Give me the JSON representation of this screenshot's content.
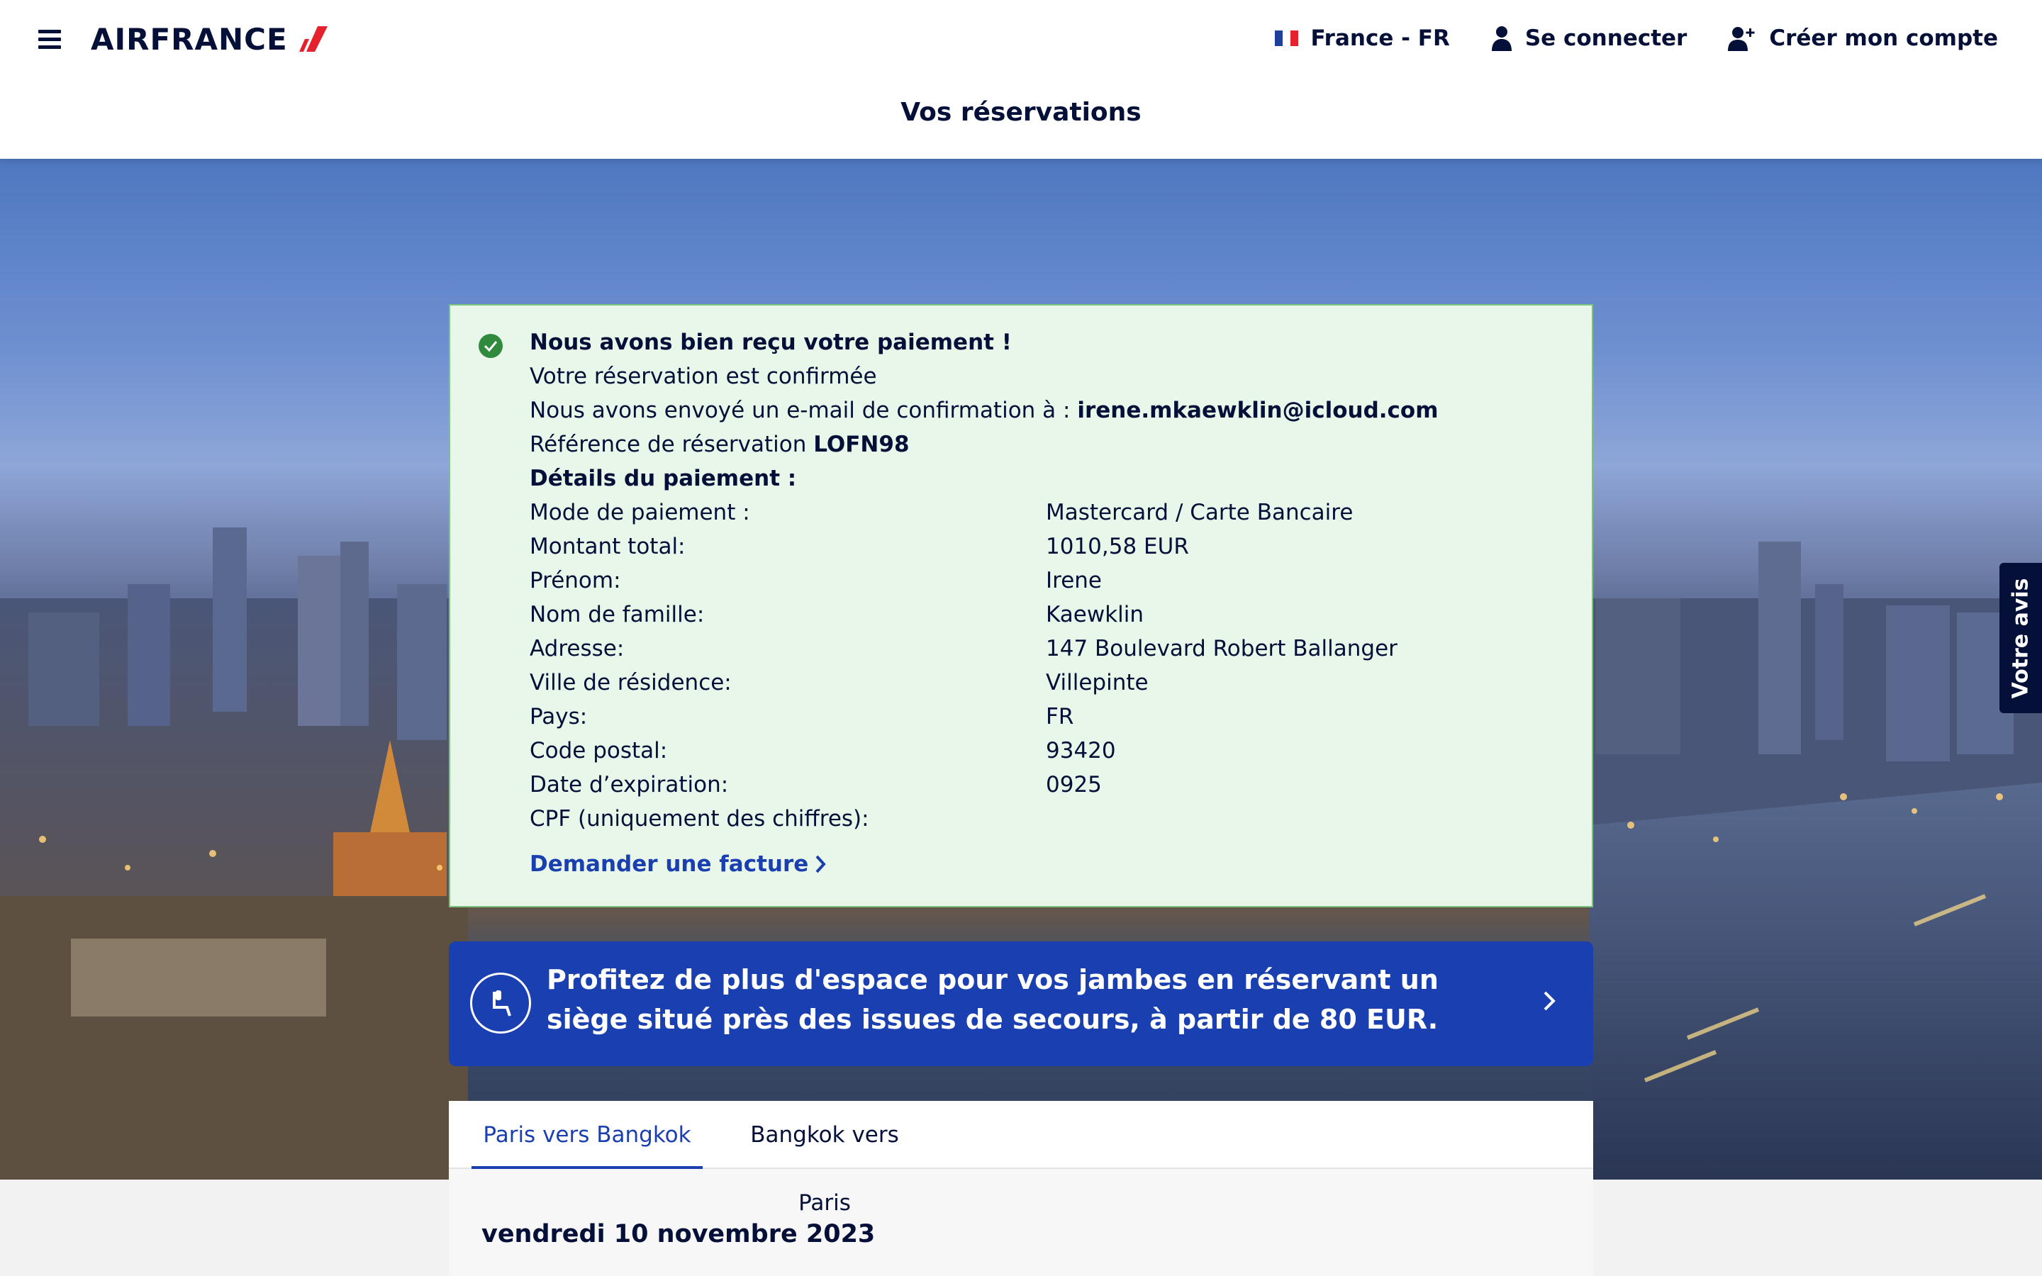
{
  "header": {
    "brand": "AIRFRANCE",
    "locale_label": "France - FR",
    "login_label": "Se connecter",
    "create_account_label": "Créer mon compte",
    "page_title": "Vos réservations"
  },
  "confirmation": {
    "title": "Nous avons bien reçu votre paiement !",
    "status": "Votre réservation est confirmée",
    "email_prefix": "Nous avons envoyé un e-mail de confirmation à : ",
    "email": "irene.mkaewklin@icloud.com",
    "reference_prefix": "Référence de réservation ",
    "reference": "LOFN98",
    "details_heading": "Détails du paiement :",
    "details": [
      {
        "label": "Mode de paiement :",
        "value": "Mastercard / Carte Bancaire"
      },
      {
        "label": "Montant total:",
        "value": "1010,58 EUR"
      },
      {
        "label": "Prénom:",
        "value": "Irene"
      },
      {
        "label": "Nom de famille:",
        "value": "Kaewklin"
      },
      {
        "label": "Adresse:",
        "value": "147 Boulevard Robert Ballanger"
      },
      {
        "label": "Ville de résidence:",
        "value": "Villepinte"
      },
      {
        "label": "Pays:",
        "value": "FR"
      },
      {
        "label": "Code postal:",
        "value": "93420"
      },
      {
        "label": "Date d’expiration:",
        "value": "0925"
      },
      {
        "label": "CPF (uniquement des chiffres):",
        "value": ""
      }
    ],
    "invoice_link": "Demander une facture"
  },
  "promo": {
    "text": "Profitez de plus d'espace pour vos jambes en réservant un siège situé près des issues de secours, à partir de 80 EUR."
  },
  "trip": {
    "tabs": [
      "Paris vers Bangkok",
      "Bangkok vers Paris"
    ],
    "active_tab": 0,
    "date": "vendredi 10 novembre 2023"
  },
  "feedback_label": "Votre avis",
  "colors": {
    "navy": "#051039",
    "brand_blue": "#1a3fb0",
    "success_bg": "#e9f7ea",
    "success_border": "#7bc47f",
    "logo_red": "#e4212c"
  }
}
